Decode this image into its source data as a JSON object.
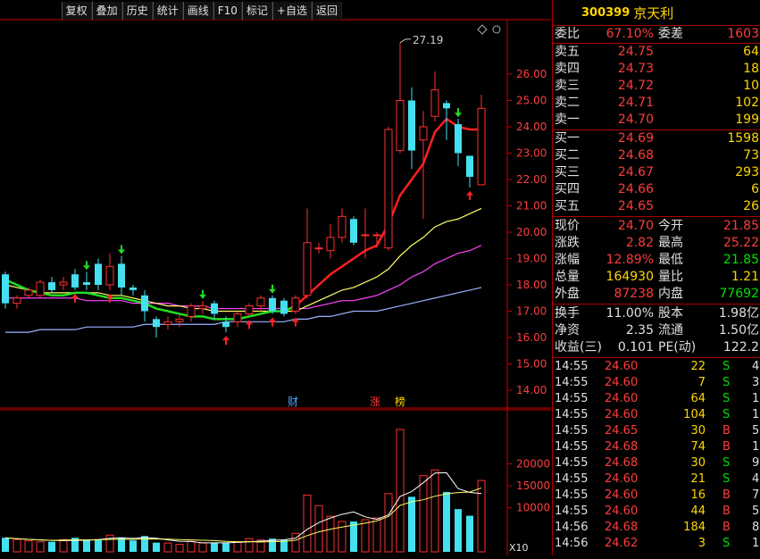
{
  "toolbar": [
    "复权",
    "叠加",
    "历史",
    "统计",
    "画线",
    "F10",
    "标记",
    "+自选",
    "返回"
  ],
  "stock": {
    "code": "300399",
    "name": "京天利"
  },
  "order_ratio": {
    "label": "委比",
    "value": "67.10%",
    "diff_label": "委差",
    "diff_value": "1603"
  },
  "asks": [
    {
      "label": "卖五",
      "price": "24.75",
      "vol": "64"
    },
    {
      "label": "卖四",
      "price": "24.73",
      "vol": "18"
    },
    {
      "label": "卖三",
      "price": "24.72",
      "vol": "10"
    },
    {
      "label": "卖二",
      "price": "24.71",
      "vol": "102"
    },
    {
      "label": "卖一",
      "price": "24.70",
      "vol": "199"
    }
  ],
  "bids": [
    {
      "label": "买一",
      "price": "24.69",
      "vol": "1598"
    },
    {
      "label": "买二",
      "price": "24.68",
      "vol": "73"
    },
    {
      "label": "买三",
      "price": "24.67",
      "vol": "293"
    },
    {
      "label": "买四",
      "price": "24.66",
      "vol": "6"
    },
    {
      "label": "买五",
      "price": "24.65",
      "vol": "26"
    }
  ],
  "quote": [
    {
      "l1": "现价",
      "v1": "24.70",
      "l2": "今开",
      "v2": "21.85"
    },
    {
      "l1": "涨跌",
      "v1": "2.82",
      "l2": "最高",
      "v2": "25.22"
    },
    {
      "l1": "涨幅",
      "v1": "12.89%",
      "l2": "最低",
      "v2": "21.85"
    },
    {
      "l1": "总量",
      "v1": "164930",
      "l2": "量比",
      "v2": "1.21"
    },
    {
      "l1": "外盘",
      "v1": "87238",
      "l2": "内盘",
      "v2": "77692"
    }
  ],
  "stats": [
    {
      "l1": "换手",
      "v1": "11.00%",
      "l2": "股本",
      "v2": "1.98亿"
    },
    {
      "l1": "净资",
      "v1": "2.35",
      "l2": "流通",
      "v2": "1.50亿"
    },
    {
      "l1": "收益(三)",
      "v1": "0.101",
      "l2": "PE(动)",
      "v2": "122.2"
    }
  ],
  "ticks": [
    {
      "time": "14:55",
      "price": "24.60",
      "vol": "22",
      "side": "S",
      "n": "4"
    },
    {
      "time": "14:55",
      "price": "24.60",
      "vol": "7",
      "side": "S",
      "n": "3"
    },
    {
      "time": "14:55",
      "price": "24.60",
      "vol": "64",
      "side": "S",
      "n": "11"
    },
    {
      "time": "14:55",
      "price": "24.60",
      "vol": "104",
      "side": "S",
      "n": "15"
    },
    {
      "time": "14:55",
      "price": "24.65",
      "vol": "30",
      "side": "B",
      "n": "5"
    },
    {
      "time": "14:55",
      "price": "24.68",
      "vol": "74",
      "side": "B",
      "n": "11"
    },
    {
      "time": "14:55",
      "price": "24.68",
      "vol": "30",
      "side": "S",
      "n": "9"
    },
    {
      "time": "14:55",
      "price": "24.60",
      "vol": "21",
      "side": "S",
      "n": "4"
    },
    {
      "time": "14:55",
      "price": "24.60",
      "vol": "16",
      "side": "B",
      "n": "7"
    },
    {
      "time": "14:55",
      "price": "24.60",
      "vol": "44",
      "side": "B",
      "n": "5"
    },
    {
      "time": "14:56",
      "price": "24.68",
      "vol": "184",
      "side": "B",
      "n": "8"
    },
    {
      "time": "14:56",
      "price": "24.62",
      "vol": "3",
      "side": "S",
      "n": "1"
    }
  ],
  "chart_data": {
    "type": "candlestick",
    "price_axis": {
      "min": 14,
      "max": 26,
      "ticks": [
        "26.00",
        "25.00",
        "24.00",
        "23.00",
        "22.00",
        "21.00",
        "20.00",
        "19.00",
        "18.00",
        "17.00",
        "16.00",
        "15.00",
        "14.00"
      ]
    },
    "max_label": "27.19",
    "markers": [
      "财",
      "涨",
      "榜"
    ],
    "candles": [
      {
        "o": 18.4,
        "c": 17.3,
        "h": 18.5,
        "l": 17.1
      },
      {
        "o": 17.3,
        "c": 17.5,
        "h": 17.6,
        "l": 17.1
      },
      {
        "o": 17.6,
        "c": 17.8,
        "h": 17.9,
        "l": 17.5
      },
      {
        "o": 17.6,
        "c": 18.1,
        "h": 18.2,
        "l": 17.5
      },
      {
        "o": 18.1,
        "c": 17.8,
        "h": 18.3,
        "l": 17.7
      },
      {
        "o": 18.0,
        "c": 18.1,
        "h": 18.3,
        "l": 17.8
      },
      {
        "o": 18.4,
        "c": 17.9,
        "h": 18.6,
        "l": 17.8
      },
      {
        "o": 18.1,
        "c": 18.0,
        "h": 18.5,
        "l": 17.8
      },
      {
        "o": 18.8,
        "c": 18.0,
        "h": 19.0,
        "l": 17.8
      },
      {
        "o": 18.0,
        "c": 18.7,
        "h": 19.2,
        "l": 17.8
      },
      {
        "o": 18.8,
        "c": 17.9,
        "h": 19.1,
        "l": 17.6
      },
      {
        "o": 17.9,
        "c": 17.8,
        "h": 18.0,
        "l": 17.6
      },
      {
        "o": 17.6,
        "c": 17.0,
        "h": 17.8,
        "l": 16.6
      },
      {
        "o": 16.7,
        "c": 16.4,
        "h": 16.8,
        "l": 16.0
      },
      {
        "o": 16.5,
        "c": 16.6,
        "h": 16.8,
        "l": 16.3
      },
      {
        "o": 16.6,
        "c": 16.7,
        "h": 16.9,
        "l": 16.4
      },
      {
        "o": 16.8,
        "c": 17.2,
        "h": 17.3,
        "l": 16.6
      },
      {
        "o": 17.1,
        "c": 17.2,
        "h": 17.4,
        "l": 16.9
      },
      {
        "o": 17.3,
        "c": 16.9,
        "h": 17.4,
        "l": 16.7
      },
      {
        "o": 16.6,
        "c": 16.4,
        "h": 16.8,
        "l": 16.2
      },
      {
        "o": 16.6,
        "c": 16.9,
        "h": 17.0,
        "l": 16.4
      },
      {
        "o": 16.9,
        "c": 17.2,
        "h": 17.3,
        "l": 16.8
      },
      {
        "o": 17.2,
        "c": 17.5,
        "h": 17.6,
        "l": 17.0
      },
      {
        "o": 17.5,
        "c": 17.0,
        "h": 17.6,
        "l": 16.9
      },
      {
        "o": 17.4,
        "c": 16.9,
        "h": 17.5,
        "l": 16.8
      },
      {
        "o": 17.0,
        "c": 17.5,
        "h": 17.6,
        "l": 16.9
      },
      {
        "o": 17.6,
        "c": 19.6,
        "h": 20.9,
        "l": 17.5
      },
      {
        "o": 19.4,
        "c": 19.4,
        "h": 19.6,
        "l": 19.2
      },
      {
        "o": 19.3,
        "c": 19.8,
        "h": 20.3,
        "l": 19.0
      },
      {
        "o": 19.8,
        "c": 20.6,
        "h": 20.9,
        "l": 19.6
      },
      {
        "o": 20.5,
        "c": 19.6,
        "h": 20.6,
        "l": 19.5
      },
      {
        "o": 19.9,
        "c": 19.9,
        "h": 20.9,
        "l": 19.0
      },
      {
        "o": 19.9,
        "c": 19.9,
        "h": 20.0,
        "l": 19.4
      },
      {
        "o": 19.4,
        "c": 23.9,
        "h": 24.0,
        "l": 19.3
      },
      {
        "o": 23.1,
        "c": 25.0,
        "h": 27.19,
        "l": 23.0
      },
      {
        "o": 25.0,
        "c": 23.1,
        "h": 25.5,
        "l": 22.4
      },
      {
        "o": 23.5,
        "c": 24.0,
        "h": 24.6,
        "l": 20.5
      },
      {
        "o": 24.4,
        "c": 25.4,
        "h": 26.1,
        "l": 24.2
      },
      {
        "o": 24.9,
        "c": 24.7,
        "h": 25.0,
        "l": 23.5
      },
      {
        "o": 24.1,
        "c": 23.0,
        "h": 24.3,
        "l": 22.5
      },
      {
        "o": 22.9,
        "c": 22.1,
        "h": 22.9,
        "l": 21.7
      },
      {
        "o": 21.8,
        "c": 24.7,
        "h": 25.22,
        "l": 21.85
      }
    ],
    "ma5": [
      18.2,
      18.0,
      17.8,
      17.7,
      17.6,
      17.6,
      17.7,
      17.7,
      17.6,
      17.5,
      17.5,
      17.4,
      17.3,
      17.1,
      17.0,
      16.9,
      16.8,
      16.8,
      16.7,
      16.7,
      16.7,
      16.8,
      16.9,
      17.0,
      17.0,
      17.2,
      17.6,
      18.0,
      18.4,
      18.7,
      19.0,
      19.3,
      19.5,
      20.3,
      21.4,
      22.0,
      22.6,
      23.8,
      24.3,
      24.0,
      23.9,
      23.9
    ],
    "ma10": [
      18.0,
      17.9,
      17.8,
      17.7,
      17.7,
      17.7,
      17.7,
      17.7,
      17.7,
      17.6,
      17.6,
      17.5,
      17.4,
      17.3,
      17.2,
      17.2,
      17.1,
      17.1,
      17.0,
      17.0,
      17.0,
      17.0,
      17.0,
      17.0,
      17.0,
      17.0,
      17.2,
      17.4,
      17.6,
      17.8,
      17.9,
      18.1,
      18.3,
      18.6,
      19.1,
      19.5,
      19.8,
      20.2,
      20.4,
      20.5,
      20.7,
      20.9
    ],
    "ma20": [
      17.5,
      17.5,
      17.5,
      17.5,
      17.5,
      17.5,
      17.5,
      17.4,
      17.4,
      17.4,
      17.4,
      17.3,
      17.3,
      17.3,
      17.3,
      17.2,
      17.2,
      17.2,
      17.1,
      17.1,
      17.1,
      17.1,
      17.1,
      17.1,
      17.1,
      17.1,
      17.1,
      17.2,
      17.3,
      17.4,
      17.4,
      17.5,
      17.6,
      17.8,
      18.0,
      18.3,
      18.5,
      18.8,
      19.0,
      19.2,
      19.3,
      19.5
    ],
    "ma60": [
      16.2,
      16.2,
      16.2,
      16.3,
      16.3,
      16.3,
      16.3,
      16.4,
      16.4,
      16.4,
      16.4,
      16.4,
      16.5,
      16.5,
      16.5,
      16.5,
      16.5,
      16.5,
      16.5,
      16.6,
      16.6,
      16.6,
      16.6,
      16.6,
      16.6,
      16.7,
      16.7,
      16.8,
      16.8,
      16.9,
      17.0,
      17.0,
      17.0,
      17.1,
      17.2,
      17.3,
      17.4,
      17.5,
      17.6,
      17.7,
      17.8,
      17.9
    ],
    "volume_axis": {
      "max": 30000,
      "ticks": [
        "20000",
        "15000",
        "10000"
      ],
      "unit": "X10"
    },
    "volumes": [
      3200,
      2800,
      2500,
      2300,
      2300,
      2800,
      3200,
      2600,
      2900,
      3800,
      3300,
      2600,
      3600,
      2100,
      2000,
      1700,
      2400,
      2000,
      2100,
      2000,
      2300,
      3000,
      2700,
      3000,
      2700,
      4200,
      12900,
      10500,
      8100,
      6900,
      6900,
      7300,
      7700,
      13200,
      27800,
      12500,
      17300,
      18600,
      13600,
      9700,
      8200,
      16200
    ]
  }
}
